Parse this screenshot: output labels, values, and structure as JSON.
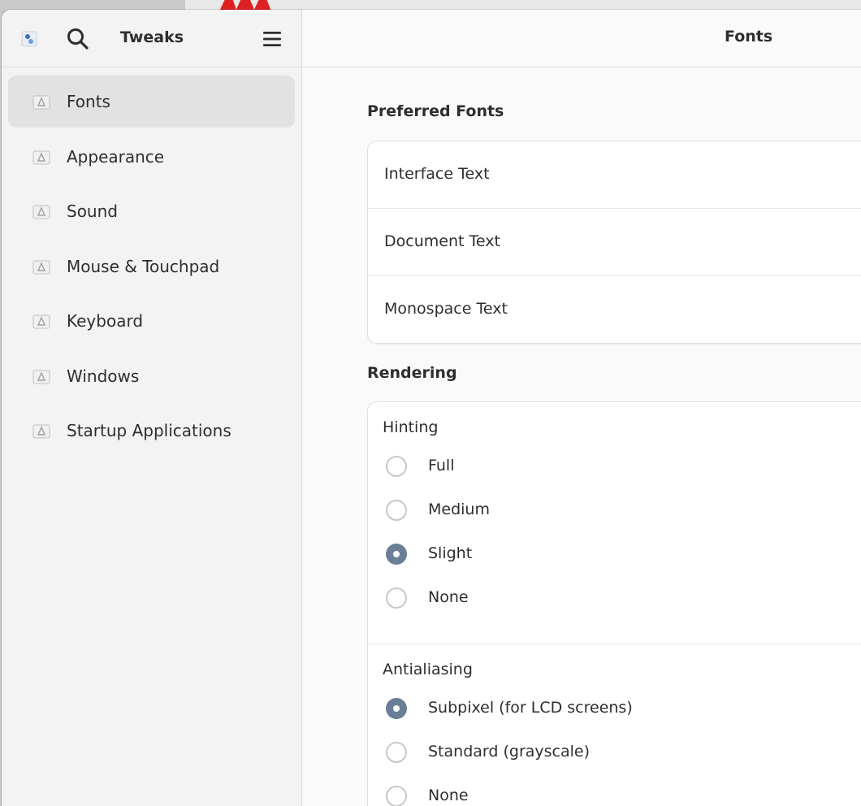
{
  "sidebar": {
    "title": "Tweaks",
    "items": [
      {
        "label": "Fonts",
        "active": true
      },
      {
        "label": "Appearance",
        "active": false
      },
      {
        "label": "Sound",
        "active": false
      },
      {
        "label": "Mouse & Touchpad",
        "active": false
      },
      {
        "label": "Keyboard",
        "active": false
      },
      {
        "label": "Windows",
        "active": false
      },
      {
        "label": "Startup Applications",
        "active": false
      }
    ]
  },
  "main": {
    "title": "Fonts",
    "preferred_fonts": {
      "title": "Preferred Fonts",
      "rows": [
        "Interface Text",
        "Document Text",
        "Monospace Text"
      ]
    },
    "rendering": {
      "title": "Rendering",
      "hinting": {
        "label": "Hinting",
        "options": [
          "Full",
          "Medium",
          "Slight",
          "None"
        ],
        "selected": "Slight"
      },
      "antialiasing": {
        "label": "Antialiasing",
        "options": [
          "Subpixel (for LCD screens)",
          "Standard (grayscale)",
          "None"
        ],
        "selected": "Subpixel (for LCD screens)"
      }
    }
  },
  "colors": {
    "accent": "#6a7e96",
    "sidebar_bg": "#f3f3f3",
    "active_item": "#e2e2e2"
  }
}
